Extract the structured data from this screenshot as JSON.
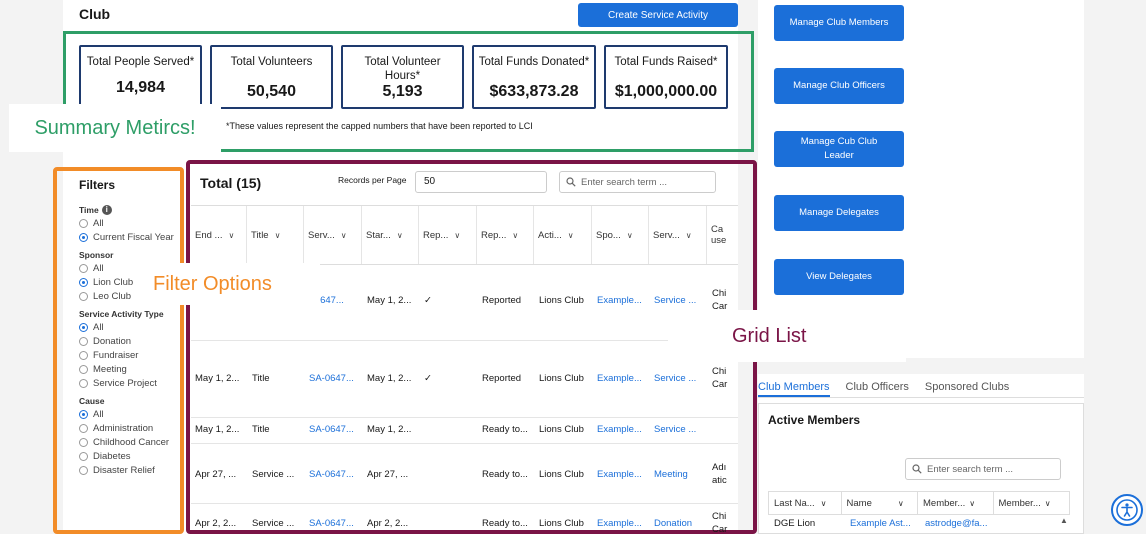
{
  "club": {
    "title": "Club",
    "create_button": "Create Service Activity"
  },
  "summary": {
    "cards": [
      {
        "label": "Total People Served*",
        "value": "14,984"
      },
      {
        "label": "Total Volunteers",
        "value": "50,540"
      },
      {
        "label": "Total Volunteer Hours*",
        "value": "5,193"
      },
      {
        "label": "Total Funds Donated*",
        "value": "$633,873.28"
      },
      {
        "label": "Total Funds Raised*",
        "value": "$1,000,000.00"
      }
    ],
    "note": "*These values represent the capped numbers that have been reported to LCI",
    "callout": "Summary Metircs!",
    "outline_color": "#2e9e67"
  },
  "filters": {
    "title": "Filters",
    "callout": "Filter Options",
    "outline_color": "#f28c28",
    "groups": [
      {
        "title": "Time",
        "options": [
          {
            "label": "All",
            "checked": false
          },
          {
            "label": "Current Fiscal Year",
            "checked": true
          }
        ]
      },
      {
        "title": "Sponsor",
        "options": [
          {
            "label": "All",
            "checked": false
          },
          {
            "label": "Lion Club",
            "checked": true
          },
          {
            "label": "Leo Club",
            "checked": false
          }
        ]
      },
      {
        "title": "Service Activity Type",
        "options": [
          {
            "label": "All",
            "checked": true
          },
          {
            "label": "Donation",
            "checked": false
          },
          {
            "label": "Fundraiser",
            "checked": false
          },
          {
            "label": "Meeting",
            "checked": false
          },
          {
            "label": "Service Project",
            "checked": false
          }
        ]
      },
      {
        "title": "Cause",
        "options": [
          {
            "label": "All",
            "checked": true
          },
          {
            "label": "Administration",
            "checked": false
          },
          {
            "label": "Childhood Cancer",
            "checked": false
          },
          {
            "label": "Diabetes",
            "checked": false
          },
          {
            "label": "Disaster Relief",
            "checked": false
          }
        ]
      }
    ]
  },
  "grid": {
    "title": "Total (15)",
    "records_per_page_label": "Records per Page",
    "records_per_page": "50",
    "search_placeholder": "Enter search term ...",
    "callout": "Grid List",
    "outline_color": "#7a1446",
    "columns": [
      "End ...",
      "Title",
      "Serv...",
      "Star...",
      "Rep...",
      "Rep...",
      "Acti...",
      "Spo...",
      "Serv...",
      "Ca use"
    ],
    "rows": [
      {
        "end": "",
        "title": "",
        "serv": ".-0647...",
        "start": "May 1, 2...",
        "rep1": "✓",
        "rep2": "Reported",
        "acti": "Lions Club",
        "spo": "Example...",
        "serv2": "Service ...",
        "cause": "Chi Car"
      },
      {
        "end": "May 1, 2...",
        "title": "Title",
        "serv": "SA-0647...",
        "start": "May 1, 2...",
        "rep1": "✓",
        "rep2": "Reported",
        "acti": "Lions Club",
        "spo": "Example...",
        "serv2": "Service ...",
        "cause": "Chi Car"
      },
      {
        "end": "May 1, 2...",
        "title": "Title",
        "serv": "SA-0647...",
        "start": "May 1, 2...",
        "rep1": "",
        "rep2": "Ready to...",
        "acti": "Lions Club",
        "spo": "Example...",
        "serv2": "Service ...",
        "cause": ""
      },
      {
        "end": "Apr 27, ...",
        "title": "Service ...",
        "serv": "SA-0647...",
        "start": "Apr 27, ...",
        "rep1": "",
        "rep2": "Ready to...",
        "acti": "Lions Club",
        "spo": "Example...",
        "serv2": "Meeting",
        "cause": "Adı atic"
      },
      {
        "end": "Apr 2, 2...",
        "title": "Service ...",
        "serv": "SA-0647...",
        "start": "Apr 2, 2...",
        "rep1": "",
        "rep2": "Ready to...",
        "acti": "Lions Club",
        "spo": "Example...",
        "serv2": "Donation",
        "cause": "Chi Car"
      }
    ]
  },
  "actions": [
    {
      "label": "Manage Club Members"
    },
    {
      "label": "Manage Club Officers"
    },
    {
      "label": "Manage Cub Club Leader"
    },
    {
      "label": "Manage Delegates"
    },
    {
      "label": "View Delegates"
    }
  ],
  "members": {
    "tabs": [
      {
        "label": "Club Members",
        "active": true
      },
      {
        "label": "Club Officers",
        "active": false
      },
      {
        "label": "Sponsored Clubs",
        "active": false
      }
    ],
    "title": "Active Members",
    "search_placeholder": "Enter search term ...",
    "columns": [
      "Last Na...",
      "Name",
      "Member...",
      "Member..."
    ],
    "row": {
      "last_name": "DGE Lion",
      "name": "Example Ast...",
      "member": "astrodge@fa..."
    }
  },
  "icons": {
    "info": "info-icon",
    "search": "search-icon",
    "chevron": "chevron-down-icon",
    "accessibility": "accessibility-icon"
  },
  "colors": {
    "accent": "#1b6fd9"
  }
}
